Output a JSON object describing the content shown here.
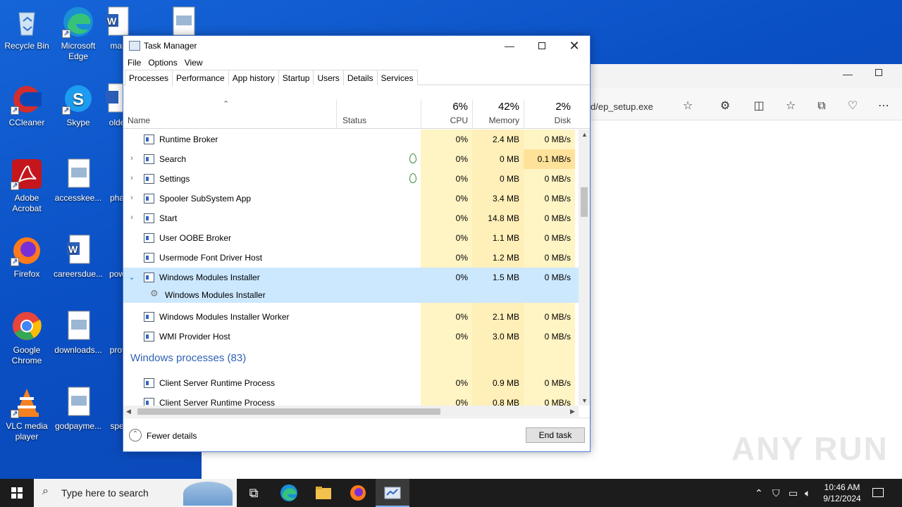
{
  "desktop_icons": [
    {
      "label": "Recycle Bin",
      "icon": "recycle-bin-icon"
    },
    {
      "label": "Microsoft Edge",
      "icon": "edge-icon"
    },
    {
      "label": "mai",
      "icon": "word-doc-icon"
    },
    {
      "label": "",
      "icon": "image-file-icon"
    },
    {
      "label": "CCleaner",
      "icon": "ccleaner-icon"
    },
    {
      "label": "Skype",
      "icon": "skype-icon"
    },
    {
      "label": "olde",
      "icon": "word-doc-icon"
    },
    {
      "label": "Adobe Acrobat",
      "icon": "acrobat-icon"
    },
    {
      "label": "accesskee...",
      "icon": "image-file-icon"
    },
    {
      "label": "pha",
      "icon": "file-icon"
    },
    {
      "label": "Firefox",
      "icon": "firefox-icon"
    },
    {
      "label": "careersdue...",
      "icon": "word-doc-icon"
    },
    {
      "label": "pow",
      "icon": "file-icon"
    },
    {
      "label": "Google Chrome",
      "icon": "chrome-icon"
    },
    {
      "label": "downloads...",
      "icon": "image-file-icon"
    },
    {
      "label": "prot",
      "icon": "word-doc-icon"
    },
    {
      "label": "VLC media player",
      "icon": "vlc-icon"
    },
    {
      "label": "godpayme...",
      "icon": "image-file-icon"
    },
    {
      "label": "spe",
      "icon": "file-icon"
    }
  ],
  "edge": {
    "url_fragment": "d/ep_setup.exe"
  },
  "task_manager": {
    "title": "Task Manager",
    "menu": [
      "File",
      "Options",
      "View"
    ],
    "tabs": [
      "Processes",
      "Performance",
      "App history",
      "Startup",
      "Users",
      "Details",
      "Services"
    ],
    "active_tab": "Processes",
    "columns": {
      "name": "Name",
      "status": "Status",
      "cpu": {
        "pct": "6%",
        "label": "CPU"
      },
      "memory": {
        "pct": "42%",
        "label": "Memory"
      },
      "disk": {
        "pct": "2%",
        "label": "Disk"
      }
    },
    "rows": [
      {
        "name": "Runtime Broker",
        "cpu": "0%",
        "mem": "2.4 MB",
        "disk": "0 MB/s"
      },
      {
        "name": "Search",
        "cpu": "0%",
        "mem": "0 MB",
        "disk": "0.1 MB/s"
      },
      {
        "name": "Settings",
        "cpu": "0%",
        "mem": "0 MB",
        "disk": "0 MB/s"
      },
      {
        "name": "Spooler SubSystem App",
        "cpu": "0%",
        "mem": "3.4 MB",
        "disk": "0 MB/s"
      },
      {
        "name": "Start",
        "cpu": "0%",
        "mem": "14.8 MB",
        "disk": "0 MB/s"
      },
      {
        "name": "User OOBE Broker",
        "cpu": "0%",
        "mem": "1.1 MB",
        "disk": "0 MB/s"
      },
      {
        "name": "Usermode Font Driver Host",
        "cpu": "0%",
        "mem": "1.2 MB",
        "disk": "0 MB/s"
      },
      {
        "name": "Windows Modules Installer",
        "cpu": "0%",
        "mem": "1.5 MB",
        "disk": "0 MB/s"
      },
      {
        "name": "Windows Modules Installer",
        "cpu": "",
        "mem": "",
        "disk": ""
      },
      {
        "name": "Windows Modules Installer Worker",
        "cpu": "0%",
        "mem": "2.1 MB",
        "disk": "0 MB/s"
      },
      {
        "name": "WMI Provider Host",
        "cpu": "0%",
        "mem": "3.0 MB",
        "disk": "0 MB/s"
      }
    ],
    "group_title": "Windows processes (83)",
    "rows2": [
      {
        "name": "Client Server Runtime Process",
        "cpu": "0%",
        "mem": "0.9 MB",
        "disk": "0 MB/s"
      },
      {
        "name": "Client Server Runtime Process",
        "cpu": "0%",
        "mem": "0.8 MB",
        "disk": "0 MB/s"
      }
    ],
    "fewer_details": "Fewer details",
    "end_task": "End task"
  },
  "taskbar": {
    "search_placeholder": "Type here to search",
    "time": "10:46 AM",
    "date": "9/12/2024"
  },
  "watermark": "ANY RUN",
  "colors": {
    "desktop": "#0b49b8",
    "cpu_heat": "#fff4c4",
    "mem_heat": "#ffe9a8",
    "selected_row": "#cce8ff",
    "group_title": "#2f62b5"
  }
}
